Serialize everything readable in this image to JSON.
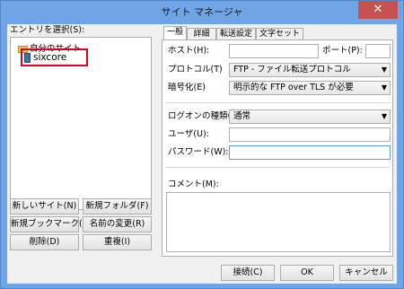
{
  "window": {
    "title": "サイト マネージャ",
    "close_glyph": "✕"
  },
  "left": {
    "entry_label": "エントリを選択(S):",
    "tree": {
      "root": "自分のサイト",
      "child": "sixcore"
    },
    "buttons": {
      "new_site": "新しいサイト(N)",
      "new_folder": "新規フォルダ(F)",
      "new_bookmark": "新規ブックマーク(M)",
      "rename": "名前の変更(R)",
      "delete": "削除(D)",
      "duplicate": "重複(I)"
    }
  },
  "tabs": [
    {
      "label": "一般"
    },
    {
      "label": "詳細"
    },
    {
      "label": "転送設定"
    },
    {
      "label": "文字セット"
    }
  ],
  "general": {
    "host_label": "ホスト(H):",
    "host_value": "",
    "port_label": "ポート(P):",
    "port_value": "",
    "protocol_label": "プロトコル(T)",
    "protocol_value": "FTP - ファイル転送プロトコル",
    "encryption_label": "暗号化(E)",
    "encryption_value": "明示的な FTP over TLS が必要",
    "logon_label": "ログオンの種類(L):",
    "logon_value": "通常",
    "user_label": "ユーザ(U):",
    "user_value": "",
    "password_label": "パスワード(W):",
    "password_value": "",
    "comment_label": "コメント(M):"
  },
  "footer": {
    "connect": "接続(C)",
    "ok": "OK",
    "cancel": "キャンセル"
  }
}
